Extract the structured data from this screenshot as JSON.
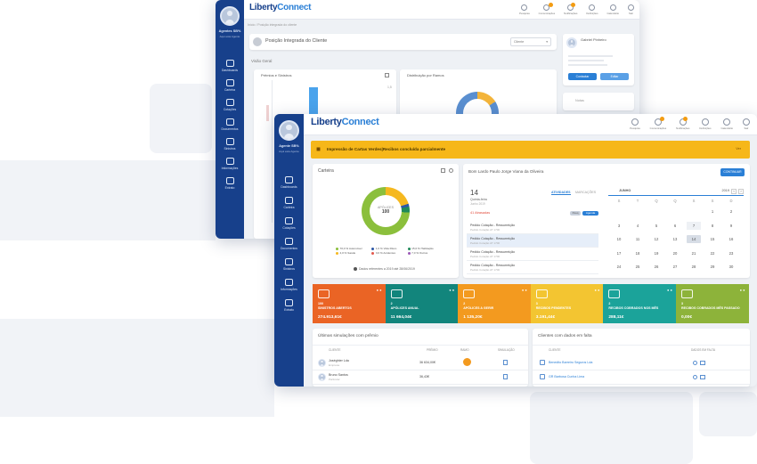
{
  "colors": {
    "sidebar": "#17408b",
    "accent": "#2a7fd6",
    "orange": "#f39c12"
  },
  "back": {
    "logo_a": "Liberty",
    "logo_b": "Connect",
    "user_name": "Agentes SB%",
    "user_sub": "Aqui esta Agente",
    "nav": [
      {
        "icon": "grid-icon",
        "label": "Dashboards"
      },
      {
        "icon": "chart-icon",
        "label": "Carteira"
      },
      {
        "icon": "doc-icon",
        "label": "Cotações"
      },
      {
        "icon": "file-icon",
        "label": "Documentos"
      },
      {
        "icon": "shield-icon",
        "label": "Sinistros"
      },
      {
        "icon": "info-icon",
        "label": "Informações"
      },
      {
        "icon": "card-icon",
        "label": "Extrato"
      }
    ],
    "top_icons": [
      "Pesquisa",
      "Comunicações",
      "Notificações",
      "Definições",
      "Calendário",
      "Sair"
    ],
    "breadcrumb": "Início  /  Posição integrada do cliente",
    "page_title": "Posição Integrada do Cliente",
    "select_value": "Cliente",
    "section": "Visão Geral",
    "panel_a": "Prêmios e Sinistros",
    "panel_b": "Distribuição por Ramos",
    "tick_top": "1,5",
    "profile_name": "Gabriel Pinheiro",
    "btn_left": "Contactar",
    "btn_right": "Editar",
    "notes_label": "Notas"
  },
  "front": {
    "logo_a": "Liberty",
    "logo_b": "Connect",
    "user_name": "Agente SB%",
    "user_sub": "Aqui esta Agente",
    "nav": [
      {
        "icon": "grid-icon",
        "label": "Dashboards"
      },
      {
        "icon": "chart-icon",
        "label": "Carteira"
      },
      {
        "icon": "doc-icon",
        "label": "Cotações"
      },
      {
        "icon": "file-icon",
        "label": "Documentos"
      },
      {
        "icon": "shield-icon",
        "label": "Sinistros"
      },
      {
        "icon": "info-icon",
        "label": "Informações"
      },
      {
        "icon": "card-icon",
        "label": "Extrato"
      }
    ],
    "top_icons": [
      "Pesquisa",
      "Comunicações",
      "Notificações",
      "Definições",
      "Calendário",
      "Sair"
    ],
    "alert": "Impressão de Cartas Verdes|Recibos concluída parcialmente",
    "alert_action": "Ver",
    "carteira": {
      "title": "Carteira",
      "center_label": "APÓLICES",
      "center_value": "100",
      "legend": [
        "70,0 % Automóvel",
        "1,0 % Vida Risco",
        "15,0 % Habitação",
        "4,0 % Saúde",
        "3,0 % Acidentes",
        "7,0 % Outros"
      ],
      "footer": "Dados referentes a 2019 até 28/06/2019"
    },
    "agenda": {
      "greeting": "Bom Lardo Paulo Jorge Viana da Oliveira",
      "button": "CONTINUAR",
      "day_num": "14",
      "day_name": "Quinta-feira",
      "day_sub": "Junho 2019",
      "tab_a": "ATIVIDADES",
      "tab_b": "MARCAÇÕES",
      "alert_label": "41 Atrasadas",
      "chip_a": "Pesq",
      "chip_b": "Agenda",
      "items": [
        {
          "title": "Pedido Cotação - Ressurreição",
          "sub": "Pedido Cotação AT 1700"
        },
        {
          "title": "Pedido Cotação - Ressurreição",
          "sub": "Pedido Cotação AT 1700"
        },
        {
          "title": "Pedido Cotação - Ressurreição",
          "sub": "Pedido Cotação AT 1700"
        },
        {
          "title": "Pedido Cotação - Ressurreição",
          "sub": "Pedido Cotação AT 1700"
        }
      ],
      "cal_month": "JUNHO",
      "cal_year": "2019",
      "week": [
        "S",
        "T",
        "Q",
        "Q",
        "S",
        "S",
        "D"
      ],
      "days": [
        "",
        "",
        "",
        "",
        "",
        "1",
        "2",
        "3",
        "4",
        "5",
        "6",
        "7",
        "8",
        "9",
        "10",
        "11",
        "12",
        "13",
        "14",
        "15",
        "16",
        "17",
        "18",
        "19",
        "20",
        "21",
        "22",
        "23",
        "24",
        "25",
        "26",
        "27",
        "28",
        "29",
        "30"
      ]
    },
    "tiles": [
      {
        "label": "100\nSINISTROS ABERTOS",
        "value": "274.913,61€",
        "color": "#ea6425"
      },
      {
        "label": "2\nAPÓLICES ANUAL",
        "value": "11 664,04€",
        "color": "#12857c"
      },
      {
        "label": "2\nAPÓLICES A GERIR",
        "value": "1 135,20€",
        "color": "#f39a1f"
      },
      {
        "label": "3\nRECIBOS PENDENTES",
        "value": "3.191,44€",
        "color": "#f3c531"
      },
      {
        "label": "2\nRECIBOS COBRADOS NOS MÊS",
        "value": "288,11€",
        "color": "#1ba39a"
      },
      {
        "label": "3\nRECIBOS COBRADOS MÊS PASSADO",
        "value": "0,00€",
        "color": "#8db33a"
      }
    ],
    "sim": {
      "title": "Últimas simulações com prêmio",
      "cols": [
        "CLIENTE",
        "PRÉMIO",
        "RAMO",
        "SIMULAÇÃO"
      ],
      "rows": [
        {
          "name": "Joséghter Lda",
          "sub": "Empresa",
          "value": "36 634,00€"
        },
        {
          "name": "Bruno Santos",
          "sub": "Particular",
          "value": "36,43€"
        }
      ]
    },
    "clients": {
      "title": "Clientes com dados em falta",
      "cols": [
        "CLIENTE",
        "DADOS EM FALTA"
      ],
      "rows": [
        {
          "name": "Benedito Barreiro Seguros Lda"
        },
        {
          "name": "GR Barbosa Cunha Lima"
        }
      ]
    }
  }
}
